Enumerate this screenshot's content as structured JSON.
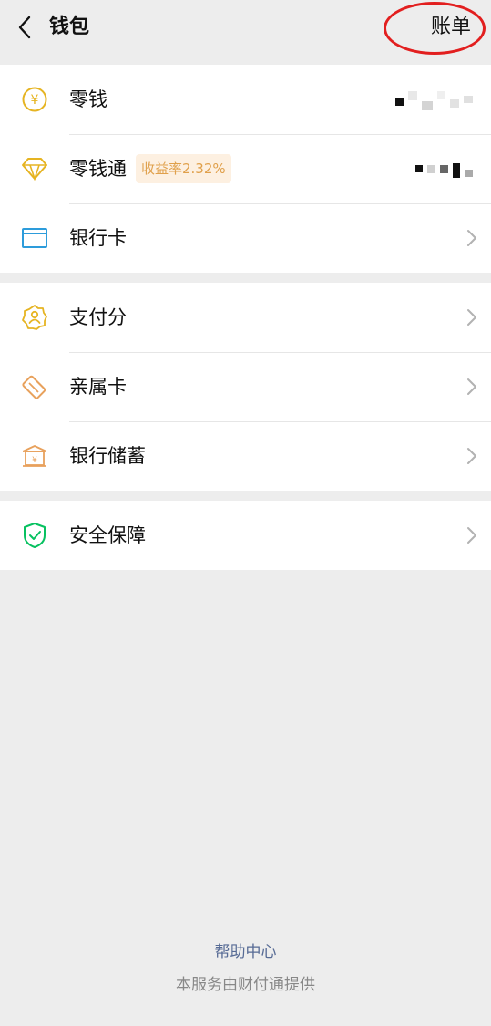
{
  "header": {
    "title": "钱包",
    "bill_label": "账单"
  },
  "groups": [
    {
      "items": [
        {
          "label": "零钱",
          "icon": "yuan-coin-icon"
        },
        {
          "label": "零钱通",
          "icon": "diamond-icon",
          "badge": "收益率2.32%"
        },
        {
          "label": "银行卡",
          "icon": "bank-card-icon"
        }
      ]
    },
    {
      "items": [
        {
          "label": "支付分",
          "icon": "payment-score-icon"
        },
        {
          "label": "亲属卡",
          "icon": "family-card-icon"
        },
        {
          "label": "银行储蓄",
          "icon": "bank-savings-icon"
        }
      ]
    },
    {
      "items": [
        {
          "label": "安全保障",
          "icon": "security-shield-icon"
        }
      ]
    }
  ],
  "footer": {
    "help_label": "帮助中心",
    "provider_label": "本服务由财付通提供"
  },
  "colors": {
    "background": "#ededed",
    "link": "#576b95",
    "badge_text": "#e0a04b",
    "badge_bg": "#fdf0e1",
    "highlight": "#e21f1f"
  }
}
